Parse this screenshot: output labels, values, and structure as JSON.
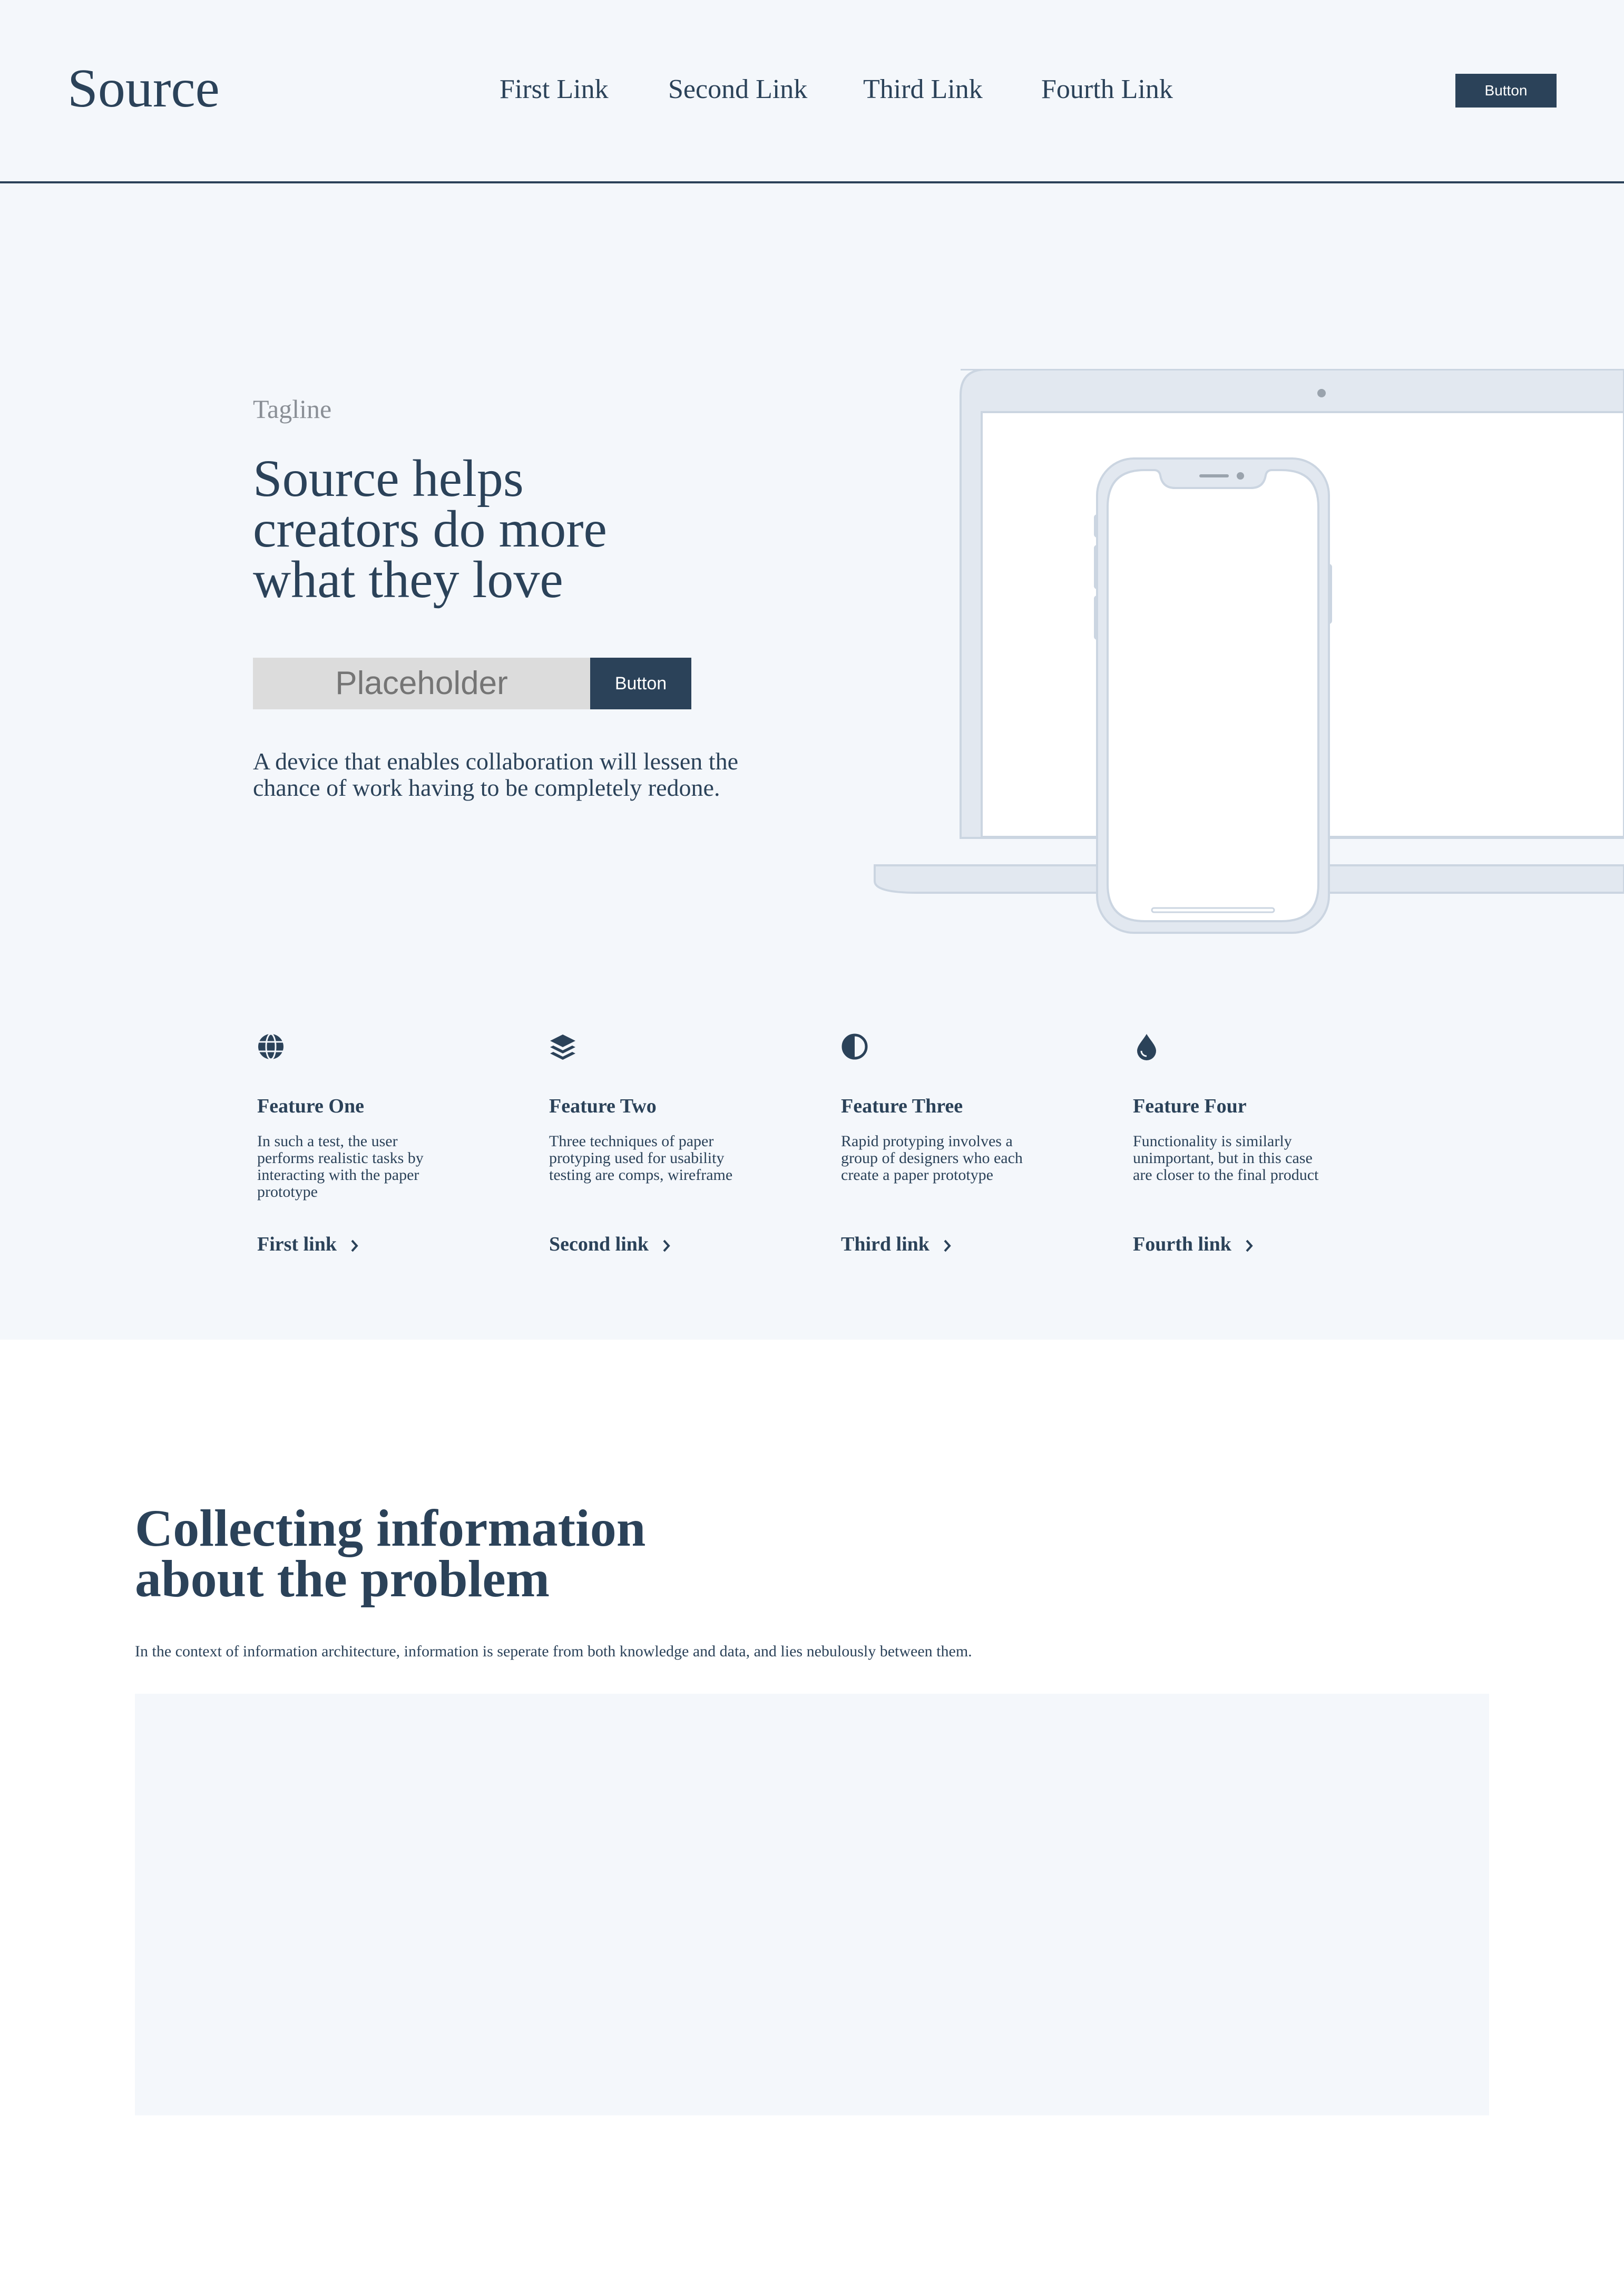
{
  "header": {
    "logo": "Source",
    "nav": [
      "First Link",
      "Second Link",
      "Third Link",
      "Fourth Link"
    ],
    "button_label": "Button"
  },
  "hero": {
    "tagline": "Tagline",
    "title_lines": [
      "Source helps",
      "creators do more",
      "what they love"
    ],
    "input_placeholder": "Placeholder",
    "button_label": "Button",
    "description_lines": [
      "A device that enables collaboration will lessen the",
      "chance of work having to be completely redone."
    ]
  },
  "features": [
    {
      "icon": "globe-icon",
      "title": "Feature One",
      "text_lines": [
        "In such a test, the user",
        "performs realistic tasks by",
        "interacting with the paper",
        "prototype"
      ],
      "link": "First link"
    },
    {
      "icon": "layers-icon",
      "title": "Feature Two",
      "text_lines": [
        "Three techniques of paper",
        "protyping used for usability",
        "testing are comps, wireframe"
      ],
      "link": "Second link"
    },
    {
      "icon": "contrast-icon",
      "title": "Feature Three",
      "text_lines": [
        "Rapid protyping involves a",
        "group of designers who each",
        "create a paper prototype"
      ],
      "link": "Third link"
    },
    {
      "icon": "droplet-icon",
      "title": "Feature Four",
      "text_lines": [
        "Functionality is similarly",
        "unimportant, but in this case",
        "are closer to the final product"
      ],
      "link": "Fourth link"
    }
  ],
  "section2": {
    "title_lines": [
      "Collecting information",
      "about the problem"
    ],
    "text": "In the context of information architecture, information is seperate from both knowledge and data, and lies nebulously between them."
  },
  "colors": {
    "primary": "#2b4259",
    "background_light": "#f4f7fb",
    "input_bg": "#dcdcdc",
    "device_fill": "#e2e8f0",
    "device_stroke": "#cbd5e1"
  }
}
